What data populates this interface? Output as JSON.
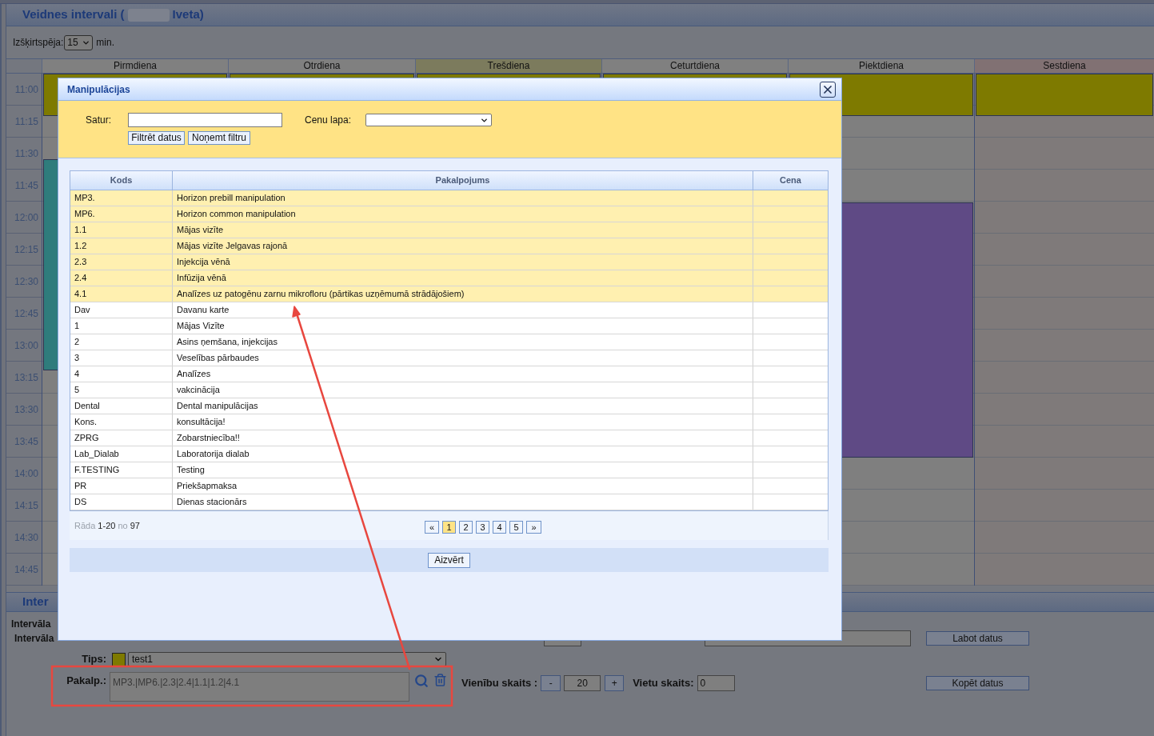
{
  "page": {
    "title_start": "Veidnes intervali (",
    "title_redacted": true,
    "title_end": "Iveta)",
    "resolution": {
      "label": "Izšķirtspēja:",
      "value": "15",
      "unit": "min."
    }
  },
  "calendar": {
    "days": [
      {
        "label": "Pirmdiena",
        "kind": "normal",
        "events": [
          {
            "color": "#7e7a00"
          },
          {
            "color": "#2f7c7c"
          }
        ]
      },
      {
        "label": "Otrdiena",
        "kind": "normal",
        "events": [
          {
            "color": "#7e7a00"
          }
        ]
      },
      {
        "label": "Trešdiena",
        "kind": "today",
        "events": [
          {
            "color": "#7e7a00"
          }
        ]
      },
      {
        "label": "Ceturtdiena",
        "kind": "normal",
        "events": [
          {
            "color": "#7e7a00"
          }
        ]
      },
      {
        "label": "Piektdiena",
        "kind": "normal",
        "events": [
          {
            "color": "#7e7a00"
          },
          {
            "color": "#5f4a85"
          }
        ]
      },
      {
        "label": "Sestdiena",
        "kind": "weekend",
        "events": [
          {
            "color": "#7e7a00"
          }
        ]
      }
    ],
    "times": [
      "11:00",
      "11:15",
      "11:30",
      "11:45",
      "12:00",
      "12:15",
      "12:30",
      "12:45",
      "13:00",
      "13:15",
      "13:30",
      "13:45",
      "14:00",
      "14:15",
      "14:30",
      "14:45"
    ]
  },
  "interval_section": {
    "title": "Inter",
    "row_1_label": "Intervāla",
    "row_2_label": "Intervāla",
    "edit_button": "Labot datus",
    "type": {
      "label": "Tips:",
      "color": "#7e7a00",
      "value": "test1"
    },
    "services": {
      "label": "Pakalp.:",
      "value": "MP3.|MP6.|2.3|2.4|1.1|1.2|4.1"
    },
    "units": {
      "label": "Vienību skaits :",
      "minus": "-",
      "value": "20",
      "plus": "+"
    },
    "places": {
      "label": "Vietu skaits:",
      "value": "0"
    },
    "copy_button": "Kopēt datus"
  },
  "dialog": {
    "title": "Manipulācijas",
    "filter": {
      "content_label": "Satur:",
      "price_list_label": "Cenu lapa:",
      "buttons": [
        "Filtrēt datus",
        "Noņemt filtru"
      ]
    },
    "table": {
      "columns": [
        "Kods",
        "Pakalpojums",
        "Cena"
      ],
      "rows": [
        {
          "code": "MP3.",
          "service": "Horizon prebill manipulation",
          "selected": true
        },
        {
          "code": "MP6.",
          "service": "Horizon common manipulation",
          "selected": true
        },
        {
          "code": "1.1",
          "service": "Mājas vizīte",
          "selected": true
        },
        {
          "code": "1.2",
          "service": "Mājas vizīte Jelgavas rajonā",
          "selected": true
        },
        {
          "code": "2.3",
          "service": "Injekcija vēnā",
          "selected": true
        },
        {
          "code": "2.4",
          "service": "Infūzija vēnā",
          "selected": true
        },
        {
          "code": "4.1",
          "service": "Analīzes uz patogēnu zarnu mikrofloru (pārtikas uzņēmumā strādājošiem)",
          "selected": true
        },
        {
          "code": "Dav",
          "service": "Davanu karte",
          "selected": false
        },
        {
          "code": "1",
          "service": "Mājas Vizīte",
          "selected": false
        },
        {
          "code": "2",
          "service": "Asins ņemšana, injekcijas",
          "selected": false
        },
        {
          "code": "3",
          "service": "Veselības pārbaudes",
          "selected": false
        },
        {
          "code": "4",
          "service": "Analīzes",
          "selected": false
        },
        {
          "code": "5",
          "service": "vakcinācija",
          "selected": false
        },
        {
          "code": "Dental",
          "service": "Dental manipulācijas",
          "selected": false
        },
        {
          "code": "Kons.",
          "service": "konsultācija!",
          "selected": false
        },
        {
          "code": "ZPRG",
          "service": "Zobarstniecība!!",
          "selected": false
        },
        {
          "code": "Lab_Dialab",
          "service": "Laboratorija dialab",
          "selected": false
        },
        {
          "code": "F.TESTING",
          "service": "Testing",
          "selected": false
        },
        {
          "code": "PR",
          "service": "Priekšapmaksa",
          "selected": false
        },
        {
          "code": "DS",
          "service": "Dienas stacionārs",
          "selected": false
        }
      ]
    },
    "footer": {
      "range": "Rāda **1-20** no **97**",
      "prev": "«",
      "pages": [
        {
          "label": "1",
          "selected": true
        },
        {
          "label": "2",
          "selected": false
        },
        {
          "label": "3",
          "selected": false
        },
        {
          "label": "4",
          "selected": false
        },
        {
          "label": "5",
          "selected": false
        }
      ],
      "next": "»"
    },
    "close_button": "Aizvērt"
  },
  "annotations": {
    "highlight_frame": true,
    "arrow": true
  }
}
